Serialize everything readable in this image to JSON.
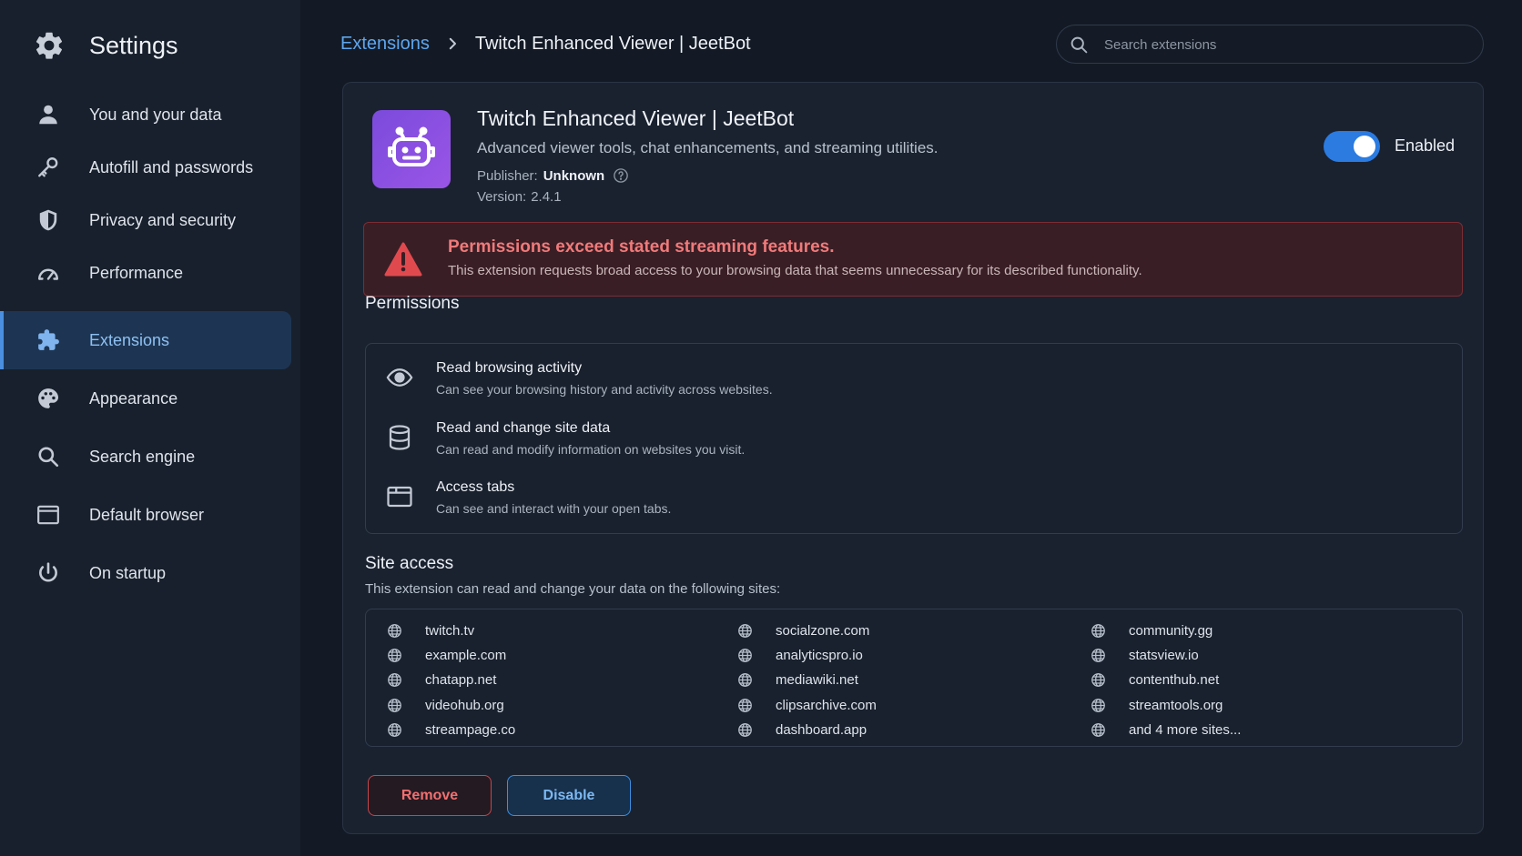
{
  "sidebar": {
    "title": "Settings",
    "items": [
      {
        "label": "You and your data",
        "icon": "person-icon"
      },
      {
        "label": "Autofill and passwords",
        "icon": "key-icon"
      },
      {
        "label": "Privacy and security",
        "icon": "shield-icon"
      },
      {
        "label": "Performance",
        "icon": "gauge-icon"
      },
      {
        "label": "Extensions",
        "icon": "puzzle-icon",
        "active": true
      },
      {
        "label": "Appearance",
        "icon": "palette-icon"
      },
      {
        "label": "Search engine",
        "icon": "search-icon"
      },
      {
        "label": "Default browser",
        "icon": "browser-window-icon"
      },
      {
        "label": "On startup",
        "icon": "power-icon"
      }
    ]
  },
  "header": {
    "breadcrumb": {
      "parent": "Extensions",
      "current": "Twitch Enhanced Viewer | JeetBot"
    },
    "search": {
      "placeholder": "Search extensions",
      "value": ""
    }
  },
  "extension": {
    "name": "Twitch Enhanced Viewer | JeetBot",
    "description": "Advanced viewer tools, chat enhancements, and streaming utilities.",
    "publisher_label": "Publisher:",
    "publisher": "Unknown",
    "version_label": "Version:",
    "version": "2.4.1",
    "toggle_label": "Enabled",
    "enabled": true
  },
  "warning": {
    "title": "Permissions exceed stated streaming features.",
    "text": "This extension requests broad access to your browsing data that seems unnecessary for its described functionality."
  },
  "permissions": {
    "title": "Permissions",
    "items": [
      {
        "title": "Read browsing activity",
        "desc": "Can see your browsing history and activity across websites.",
        "icon": "eye-icon"
      },
      {
        "title": "Read and change site data",
        "desc": "Can read and modify information on websites you visit.",
        "icon": "database-icon"
      },
      {
        "title": "Access tabs",
        "desc": "Can see and interact with your open tabs.",
        "icon": "tab-window-icon"
      }
    ]
  },
  "site_access": {
    "title": "Site access",
    "subtitle": "This extension can read and change your data on the following sites:",
    "columns": [
      [
        "twitch.tv",
        "example.com",
        "chatapp.net",
        "videohub.org",
        "streampage.co"
      ],
      [
        "socialzone.com",
        "analyticspro.io",
        "mediawiki.net",
        "clipsarchive.com",
        "dashboard.app"
      ],
      [
        "community.gg",
        "statsview.io",
        "contenthub.net",
        "streamtools.org",
        "and 4 more sites..."
      ]
    ]
  },
  "actions": {
    "remove": "Remove",
    "disable": "Disable"
  },
  "colors": {
    "accent": "#4a8fe0",
    "danger": "#e04a4f",
    "toggle_on": "#2b7be0",
    "ext_icon": "#8b50e2"
  }
}
